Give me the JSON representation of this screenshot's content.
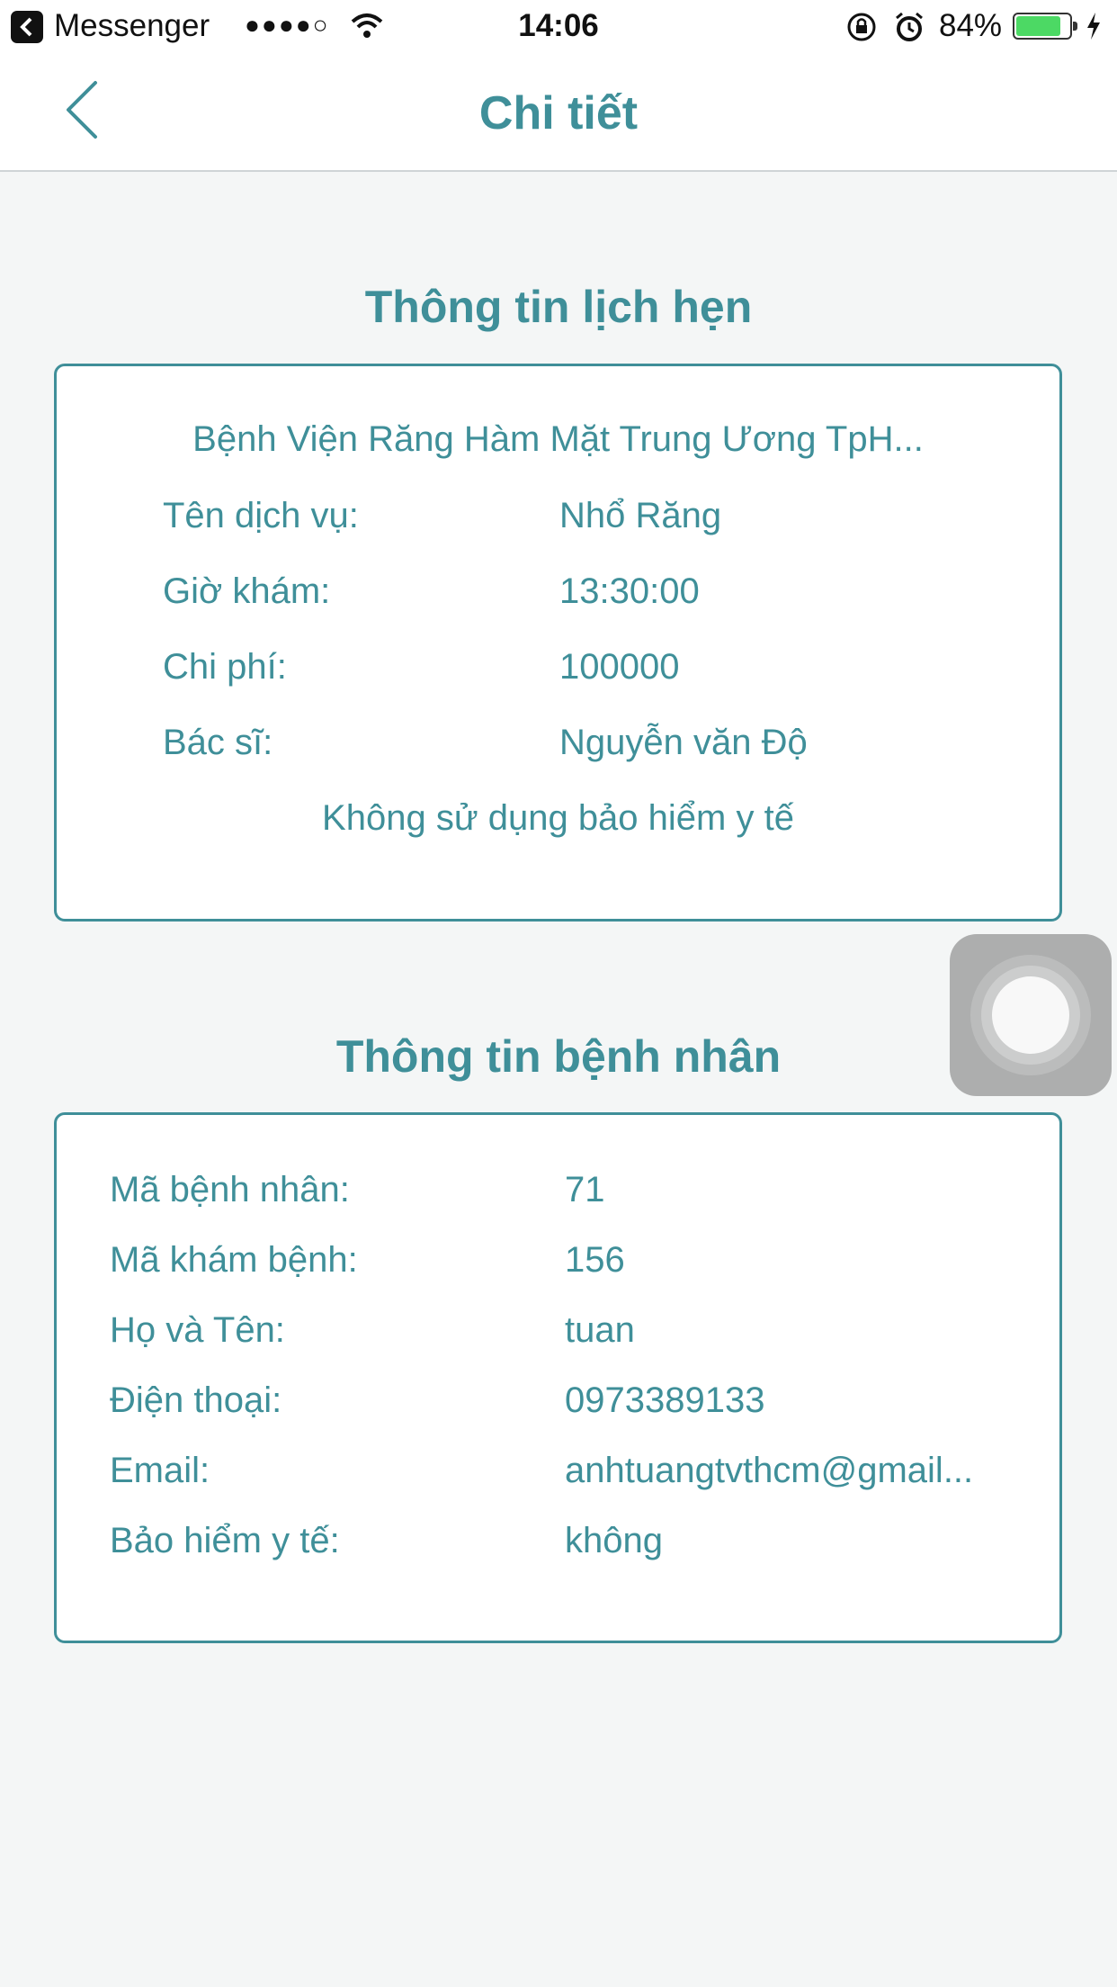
{
  "status_bar": {
    "app_name": "Messenger",
    "signal": "●●●●○",
    "time": "14:06",
    "battery_percent": "84%",
    "battery_level": 0.84
  },
  "nav": {
    "title": "Chi tiết",
    "back_icon": "chevron-left-icon"
  },
  "appointment": {
    "section_title": "Thông tin lịch hẹn",
    "hospital": "Bệnh Viện Răng Hàm Mặt Trung Ương TpH...",
    "rows": [
      {
        "label": "Tên dịch vụ:",
        "value": "Nhổ Răng"
      },
      {
        "label": "Giờ khám:",
        "value": "13:30:00"
      },
      {
        "label": "Chi phí:",
        "value": "100000"
      },
      {
        "label": "Bác sĩ:",
        "value": "Nguyễn văn Độ"
      }
    ],
    "insurance_note": "Không sử dụng bảo hiểm y tế"
  },
  "patient": {
    "section_title": "Thông tin bệnh nhân",
    "rows": [
      {
        "label": "Mã bệnh nhân:",
        "value": "71"
      },
      {
        "label": "Mã khám bệnh:",
        "value": "156"
      },
      {
        "label": "Họ và Tên:",
        "value": "tuan"
      },
      {
        "label": "Điện thoại:",
        "value": "0973389133"
      },
      {
        "label": "Email:",
        "value": "anhtuangtvthcm@gmail..."
      },
      {
        "label": "Bảo hiểm y tế:",
        "value": "không"
      }
    ]
  },
  "colors": {
    "accent": "#3f8f99",
    "background": "#f4f6f6"
  }
}
